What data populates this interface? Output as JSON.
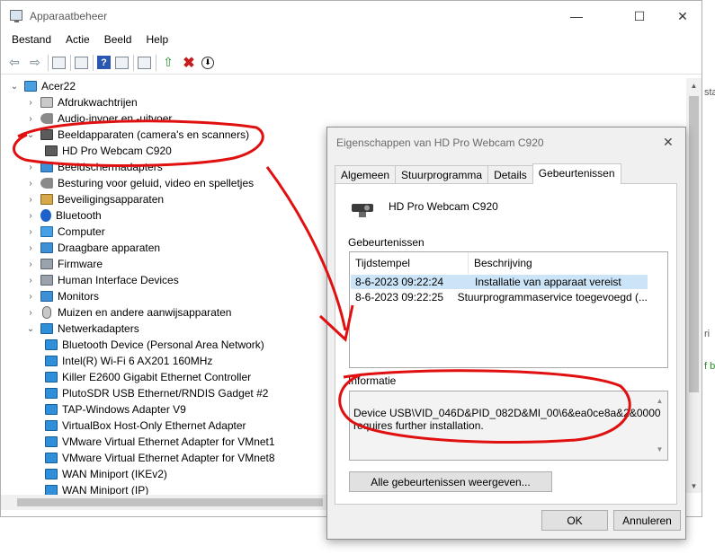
{
  "window": {
    "title": "Apparaatbeheer",
    "minimize": "—",
    "maximize": "☐",
    "close": "✕"
  },
  "menu": [
    "Bestand",
    "Actie",
    "Beeld",
    "Help"
  ],
  "toolbar": {
    "back_glyph": "⇦",
    "forward_glyph": "⇨",
    "help_glyph": "?",
    "uninstall_glyph": "✖",
    "update_glyph": "⇧",
    "download_glyph": "⬇",
    "scan_glyph": "▭"
  },
  "tree": {
    "root": "Acer22",
    "items": [
      {
        "label": "Afdrukwachtrijen",
        "expanded": false,
        "icon": "printer-icon"
      },
      {
        "label": "Audio-invoer en -uitvoer",
        "expanded": false,
        "icon": "speaker-icon"
      },
      {
        "label": "Beeldapparaten (camera's en scanners)",
        "expanded": true,
        "icon": "camera-icon"
      },
      {
        "label": "HD Pro Webcam C920",
        "child": true,
        "icon": "webcam-warning-icon"
      },
      {
        "label": "Beeldschermadapters",
        "expanded": false,
        "icon": "monitor-icon"
      },
      {
        "label": "Besturing voor geluid, video en spelletjes",
        "expanded": false,
        "icon": "speaker-icon"
      },
      {
        "label": "Beveiligingsapparaten",
        "expanded": false,
        "icon": "lock-icon"
      },
      {
        "label": "Bluetooth",
        "expanded": false,
        "icon": "bluetooth-icon"
      },
      {
        "label": "Computer",
        "expanded": false,
        "icon": "computer-icon"
      },
      {
        "label": "Draagbare apparaten",
        "expanded": false,
        "icon": "monitor-icon"
      },
      {
        "label": "Firmware",
        "expanded": false,
        "icon": "chip-icon"
      },
      {
        "label": "Human Interface Devices",
        "expanded": false,
        "icon": "hid-icon"
      },
      {
        "label": "Monitors",
        "expanded": false,
        "icon": "monitor-icon"
      },
      {
        "label": "Muizen en andere aanwijsapparaten",
        "expanded": false,
        "icon": "mouse-icon"
      },
      {
        "label": "Netwerkadapters",
        "expanded": true,
        "icon": "network-icon"
      },
      {
        "label": "Bluetooth Device (Personal Area Network)",
        "child": true,
        "icon": "network-icon"
      },
      {
        "label": "Intel(R) Wi-Fi 6 AX201 160MHz",
        "child": true,
        "icon": "network-icon"
      },
      {
        "label": "Killer E2600 Gigabit Ethernet Controller",
        "child": true,
        "icon": "network-icon"
      },
      {
        "label": "PlutoSDR USB Ethernet/RNDIS Gadget #2",
        "child": true,
        "icon": "network-icon"
      },
      {
        "label": "TAP-Windows Adapter V9",
        "child": true,
        "icon": "network-icon"
      },
      {
        "label": "VirtualBox Host-Only Ethernet Adapter",
        "child": true,
        "icon": "network-icon"
      },
      {
        "label": "VMware Virtual Ethernet Adapter for VMnet1",
        "child": true,
        "icon": "network-icon"
      },
      {
        "label": "VMware Virtual Ethernet Adapter for VMnet8",
        "child": true,
        "icon": "network-icon"
      },
      {
        "label": "WAN Miniport (IKEv2)",
        "child": true,
        "icon": "network-icon"
      },
      {
        "label": "WAN Miniport (IP)",
        "child": true,
        "icon": "network-icon"
      }
    ]
  },
  "dialog": {
    "title": "Eigenschappen van HD Pro Webcam C920",
    "close": "✕",
    "tabs": [
      "Algemeen",
      "Stuurprogramma",
      "Details",
      "Gebeurtenissen"
    ],
    "active_tab": "Gebeurtenissen",
    "device_name": "HD Pro Webcam C920",
    "events_label": "Gebeurtenissen",
    "events_columns": [
      "Tijdstempel",
      "Beschrijving"
    ],
    "events": [
      {
        "time": "8-6-2023 09:22:24",
        "desc": "Installatie van apparaat vereist"
      },
      {
        "time": "8-6-2023 09:22:25",
        "desc": "Stuurprogrammaservice toegevoegd (..."
      }
    ],
    "info_label": "Informatie",
    "info_text": "Device USB\\VID_046D&PID_082D&MI_00\\6&ea0ce8a&2&0000\nrequires further installation.",
    "all_events_button": "Alle gebeurtenissen weergeven...",
    "ok_button": "OK",
    "cancel_button": "Annuleren"
  },
  "edge_fragments": [
    "sta",
    "ri",
    "f b"
  ],
  "colors": {
    "annotation_red": "#e01010",
    "selection": "#cce4f7"
  }
}
